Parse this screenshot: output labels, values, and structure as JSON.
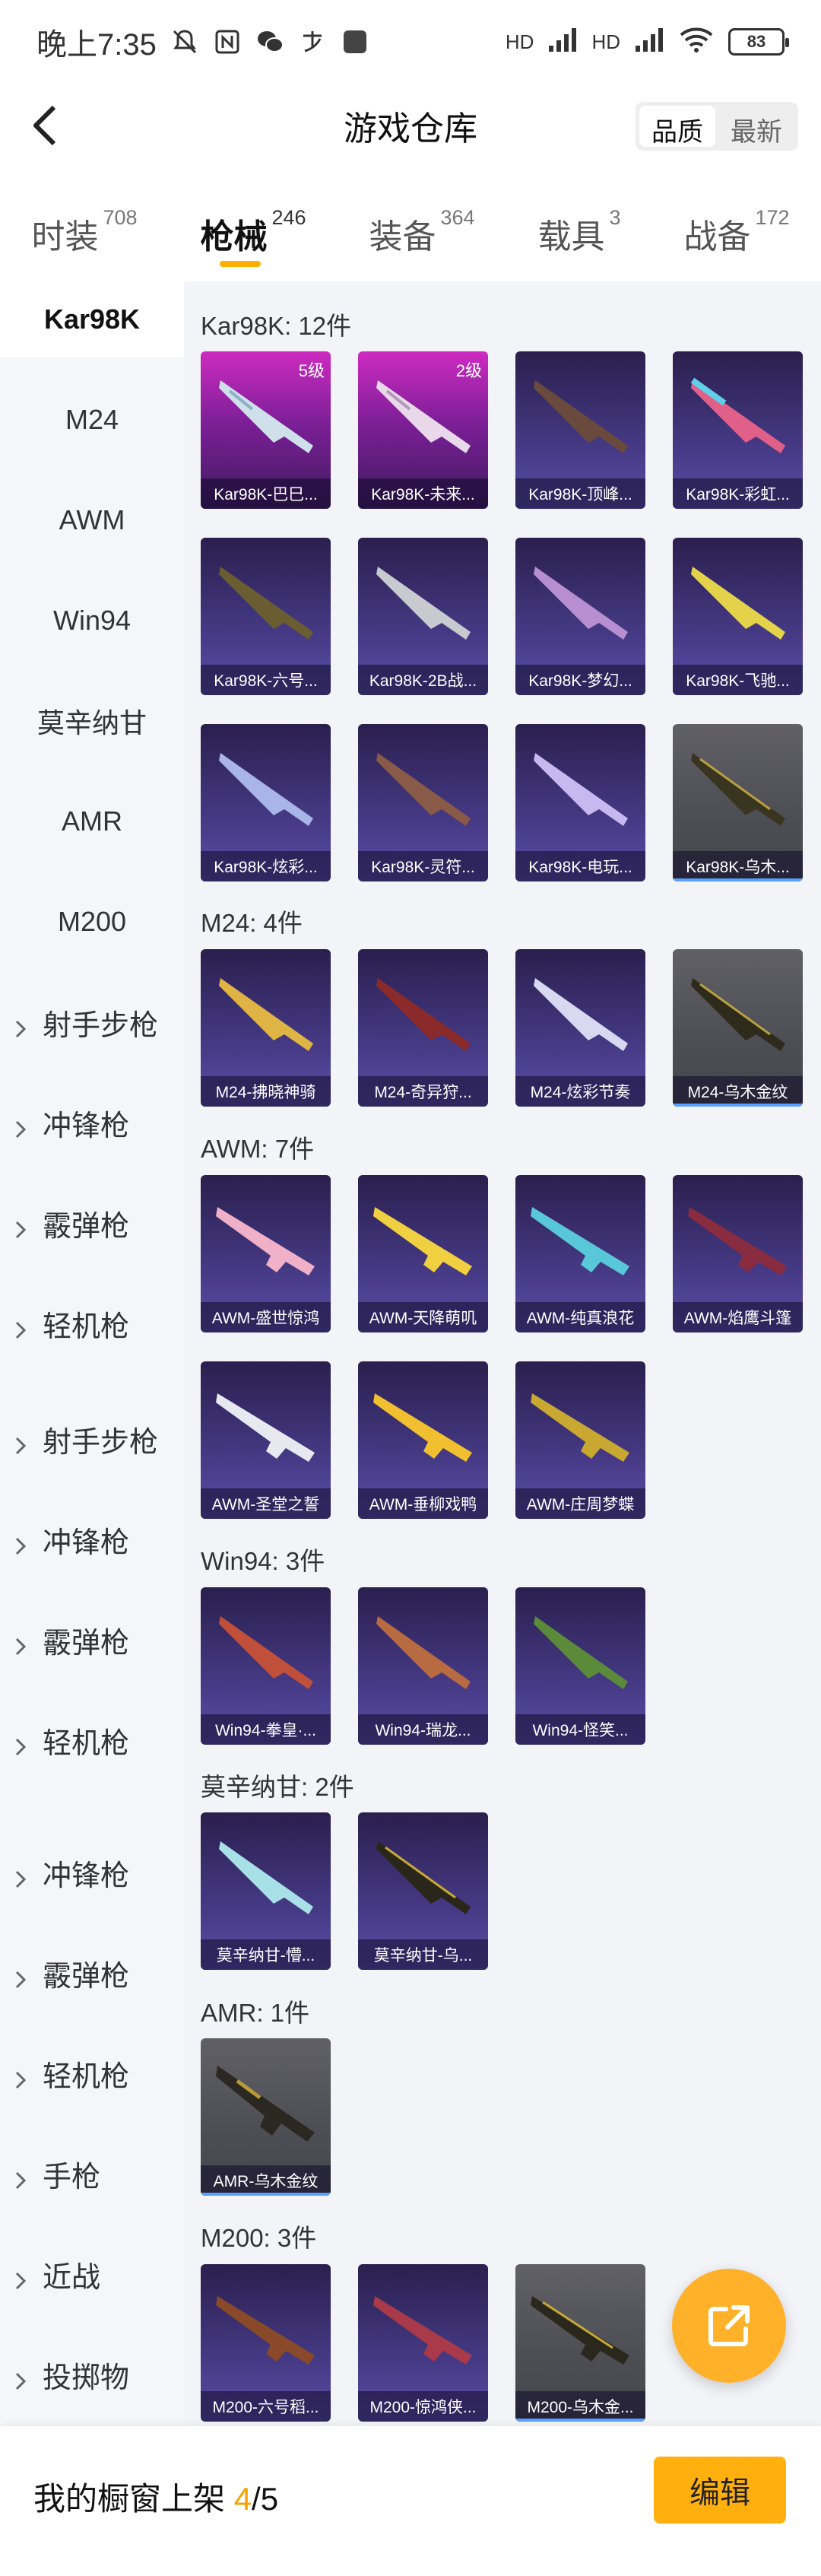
{
  "status_bar": {
    "time": "晚上7:35",
    "signal1": "HD",
    "signal2": "HD",
    "battery": "83"
  },
  "header": {
    "title": "游戏仓库",
    "sort_options": [
      "品质",
      "最新"
    ]
  },
  "tabs": [
    {
      "label": "时装",
      "count": "708"
    },
    {
      "label": "枪械",
      "count": "246"
    },
    {
      "label": "装备",
      "count": "364"
    },
    {
      "label": "载具",
      "count": "3"
    },
    {
      "label": "战备",
      "count": "172"
    }
  ],
  "sidebar": [
    "Kar98K",
    "M24",
    "AWM",
    "Win94",
    "莫辛纳甘",
    "AMR",
    "M200",
    "射手步枪",
    "冲锋枪",
    "霰弹枪",
    "轻机枪",
    "射手步枪",
    "冲锋枪",
    "霰弹枪",
    "轻机枪",
    "冲锋枪",
    "霰弹枪",
    "轻机枪",
    "手枪",
    "近战",
    "投掷物"
  ],
  "sections": [
    {
      "title": "Kar98K: 12件",
      "items": [
        {
          "label": "Kar98K-巴巳...",
          "level": "5级"
        },
        {
          "label": "Kar98K-未来...",
          "level": "2级"
        },
        {
          "label": "Kar98K-顶峰..."
        },
        {
          "label": "Kar98K-彩虹..."
        },
        {
          "label": "Kar98K-六号..."
        },
        {
          "label": "Kar98K-2B战..."
        },
        {
          "label": "Kar98K-梦幻..."
        },
        {
          "label": "Kar98K-飞驰..."
        },
        {
          "label": "Kar98K-炫彩..."
        },
        {
          "label": "Kar98K-灵符..."
        },
        {
          "label": "Kar98K-电玩..."
        },
        {
          "label": "Kar98K-乌木..."
        }
      ]
    },
    {
      "title": "M24: 4件",
      "items": [
        {
          "label": "M24-拂晓神骑"
        },
        {
          "label": "M24-奇异狩..."
        },
        {
          "label": "M24-炫彩节奏"
        },
        {
          "label": "M24-乌木金纹"
        }
      ]
    },
    {
      "title": "AWM: 7件",
      "items": [
        {
          "label": "AWM-盛世惊鸿"
        },
        {
          "label": "AWM-天降萌叽"
        },
        {
          "label": "AWM-纯真浪花"
        },
        {
          "label": "AWM-焰鹰斗篷"
        },
        {
          "label": "AWM-圣堂之誓"
        },
        {
          "label": "AWM-垂柳戏鸭"
        },
        {
          "label": "AWM-庄周梦蝶"
        }
      ]
    },
    {
      "title": "Win94: 3件",
      "items": [
        {
          "label": "Win94-拳皇·..."
        },
        {
          "label": "Win94-瑞龙..."
        },
        {
          "label": "Win94-怪笑..."
        }
      ]
    },
    {
      "title": "莫辛纳甘: 2件",
      "items": [
        {
          "label": "莫辛纳甘-懵..."
        },
        {
          "label": "莫辛纳甘-乌..."
        }
      ]
    },
    {
      "title": "AMR: 1件",
      "items": [
        {
          "label": "AMR-乌木金纹"
        }
      ]
    },
    {
      "title": "M200: 3件",
      "items": [
        {
          "label": "M200-六号稻..."
        },
        {
          "label": "M200-惊鸿侠..."
        },
        {
          "label": "M200-乌木金..."
        }
      ]
    }
  ],
  "bottom_bar": {
    "shelf_label": "我的橱窗上架",
    "shelf_current": "4",
    "shelf_total": "/5",
    "edit_label": "编辑"
  }
}
